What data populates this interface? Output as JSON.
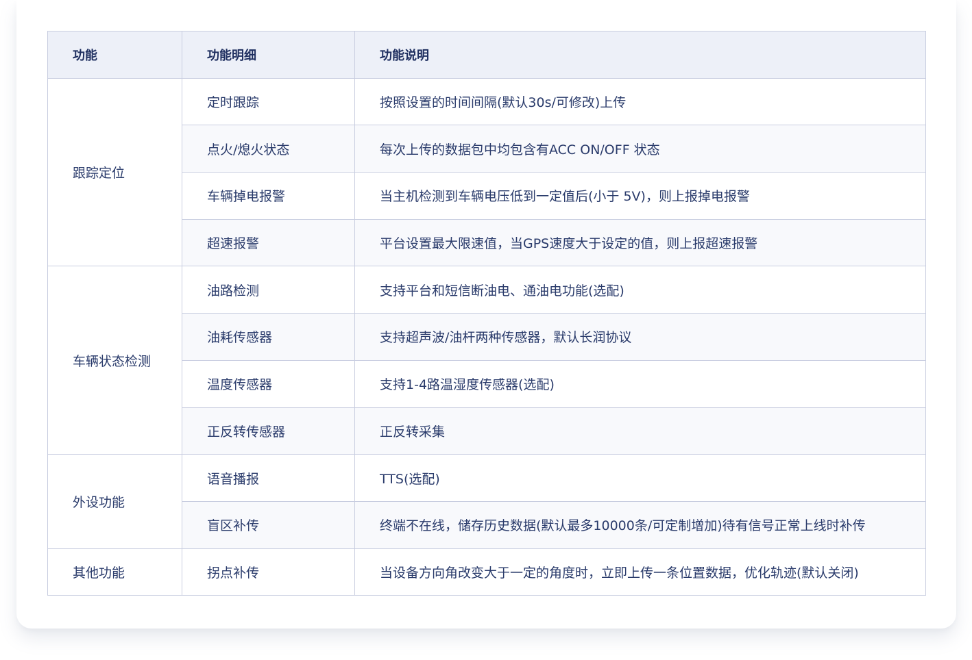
{
  "table": {
    "headers": [
      "功能",
      "功能明细",
      "功能说明"
    ],
    "groups": [
      {
        "name": "跟踪定位",
        "rows": [
          {
            "detail": "定时跟踪",
            "desc": "按照设置的时间间隔(默认30s/可修改)上传"
          },
          {
            "detail": "点火/熄火状态",
            "desc": "每次上传的数据包中均包含有ACC ON/OFF 状态"
          },
          {
            "detail": "车辆掉电报警",
            "desc": "当主机检测到车辆电压低到一定值后(小于 5V)，则上报掉电报警"
          },
          {
            "detail": "超速报警",
            "desc": "平台设置最大限速值，当GPS速度大于设定的值，则上报超速报警"
          }
        ]
      },
      {
        "name": "车辆状态检测",
        "rows": [
          {
            "detail": "油路检测",
            "desc": "支持平台和短信断油电、通油电功能(选配)"
          },
          {
            "detail": "油耗传感器",
            "desc": "支持超声波/油杆两种传感器，默认长润协议"
          },
          {
            "detail": "温度传感器",
            "desc": "支持1-4路温湿度传感器(选配)"
          },
          {
            "detail": "正反转传感器",
            "desc": "正反转采集"
          }
        ]
      },
      {
        "name": "外设功能",
        "rows": [
          {
            "detail": "语音播报",
            "desc": "TTS(选配)"
          },
          {
            "detail": "盲区补传",
            "desc": "终端不在线，储存历史数据(默认最多10000条/可定制增加)待有信号正常上线时补传"
          }
        ]
      },
      {
        "name": "其他功能",
        "rows": [
          {
            "detail": "拐点补传",
            "desc": "当设备方向角改变大于一定的角度时，立即上传一条位置数据，优化轨迹(默认关闭)"
          }
        ]
      }
    ]
  }
}
